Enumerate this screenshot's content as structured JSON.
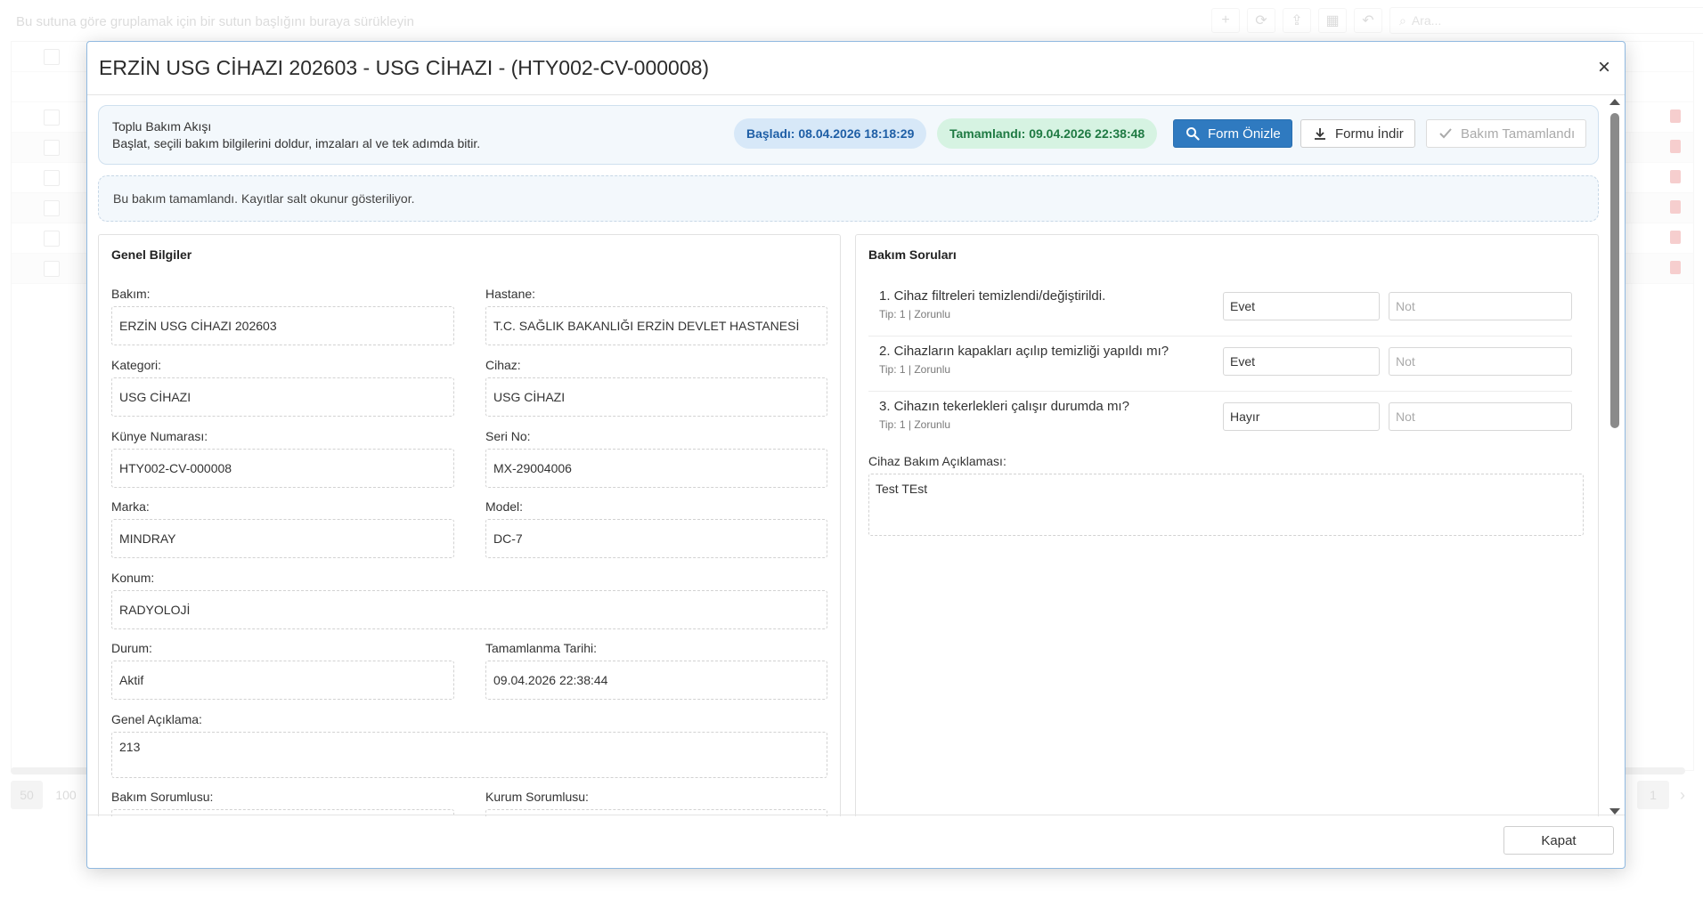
{
  "background": {
    "group_hint": "Bu sutuna göre gruplamak için bir sutun başlığını buraya sürükleyin",
    "search_placeholder": "Ara...",
    "page_sizes": [
      "50",
      "100"
    ],
    "current_page": "1"
  },
  "modal": {
    "title": "ERZİN USG CİHAZI 202603 - USG CİHAZI - (HTY002-CV-000008)",
    "close_label": "×",
    "footer_close": "Kapat"
  },
  "flow": {
    "title": "Toplu Bakım Akışı",
    "description": "Başlat, seçili bakım bilgilerini doldur, imzaları al ve tek adımda bitir.",
    "started": "Başladı: 08.04.2026 18:18:29",
    "completed": "Tamamlandı: 09.04.2026 22:38:48",
    "btn_preview": "Form Önizle",
    "btn_download": "Formu İndir",
    "btn_complete": "Bakım Tamamlandı"
  },
  "notice": "Bu bakım tamamlandı. Kayıtlar salt okunur gösteriliyor.",
  "general": {
    "title": "Genel Bilgiler",
    "fields": {
      "bakim": {
        "label": "Bakım:",
        "value": "ERZİN USG CİHAZI 202603"
      },
      "hastane": {
        "label": "Hastane:",
        "value": "T.C. SAĞLIK BAKANLIĞI ERZİN DEVLET HASTANESİ"
      },
      "kategori": {
        "label": "Kategori:",
        "value": "USG CİHAZI"
      },
      "cihaz": {
        "label": "Cihaz:",
        "value": "USG CİHAZI"
      },
      "kunye": {
        "label": "Künye Numarası:",
        "value": "HTY002-CV-000008"
      },
      "seri": {
        "label": "Seri No:",
        "value": "MX-29004006"
      },
      "marka": {
        "label": "Marka:",
        "value": "MINDRAY"
      },
      "model": {
        "label": "Model:",
        "value": "DC-7"
      },
      "konum": {
        "label": "Konum:",
        "value": "RADYOLOJİ"
      },
      "durum": {
        "label": "Durum:",
        "value": "Aktif"
      },
      "tamamlanma": {
        "label": "Tamamlanma Tarihi:",
        "value": "09.04.2026 22:38:44"
      },
      "aciklama": {
        "label": "Genel Açıklama:",
        "value": "213"
      },
      "bakim_sorumlusu": {
        "label": "Bakım Sorumlusu:",
        "value": ""
      },
      "kurum_sorumlusu": {
        "label": "Kurum Sorumlusu:",
        "value": ""
      }
    }
  },
  "questions": {
    "title": "Bakım Soruları",
    "items": [
      {
        "text": "1. Cihaz filtreleri temizlendi/değiştirildi.",
        "meta": "Tip: 1 | Zorunlu",
        "answer": "Evet",
        "note_placeholder": "Not"
      },
      {
        "text": "2. Cihazların kapakları açılıp temizliği yapıldı mı?",
        "meta": "Tip: 1 | Zorunlu",
        "answer": "Evet",
        "note_placeholder": "Not"
      },
      {
        "text": "3. Cihazın tekerlekleri çalışır durumda mı?",
        "meta": "Tip: 1 | Zorunlu",
        "answer": "Hayır",
        "note_placeholder": "Not"
      }
    ],
    "description_label": "Cihaz Bakım Açıklaması:",
    "description_value": "Test TEst"
  },
  "colors": {
    "primary": "#2f7ac0",
    "started_bg": "#d7e8f8",
    "started_fg": "#1f5fa6",
    "done_bg": "#d6f3e2",
    "done_fg": "#1f7a43"
  }
}
